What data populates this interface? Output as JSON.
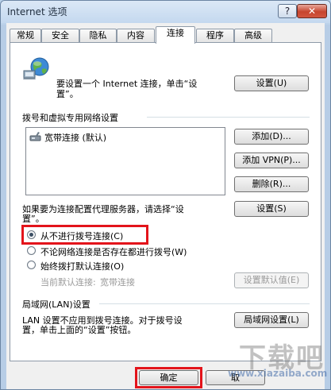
{
  "window": {
    "title": "Internet 选项",
    "help_label": "?",
    "close_label": "✕"
  },
  "tabs": [
    {
      "label": "常规",
      "active": false
    },
    {
      "label": "安全",
      "active": false
    },
    {
      "label": "隐私",
      "active": false
    },
    {
      "label": "内容",
      "active": false
    },
    {
      "label": "连接",
      "active": true
    },
    {
      "label": "程序",
      "active": false
    },
    {
      "label": "高级",
      "active": false
    }
  ],
  "connections": {
    "setup_text_line1": "要设置一个 Internet 连接，单击“设",
    "setup_text_line2": "置”。",
    "setup_button": "设置(U)",
    "dialup_section_label": "拨号和虚拟专用网络设置",
    "dialup_list": [
      {
        "label": "宽带连接 (默认)",
        "icon": "broadband-connection-icon"
      }
    ],
    "add_button": "添加(D)...",
    "add_vpn_button": "添加 VPN(P)...",
    "remove_button": "删除(R)...",
    "proxy_text_line1": "如果要为连接配置代理服务器，请选择“设",
    "proxy_text_line2": "置”。",
    "settings_button": "设置(S)",
    "radio_options": [
      {
        "label": "从不进行拨号连接(C)",
        "selected": true
      },
      {
        "label": "不论网络连接是否存在都进行拨号(W)",
        "selected": false
      },
      {
        "label": "始终拨打默认连接(O)",
        "selected": false
      }
    ],
    "current_default_label": "当前默认连接:",
    "current_default_value": "宽带连接",
    "set_default_button": "设置默认值(E)",
    "lan_section_label": "局域网(LAN)设置",
    "lan_text_line1": "LAN 设置不应用到拨号连接。对于拨号设",
    "lan_text_line2": "置，单击上面的“设置”按钮。",
    "lan_settings_button": "局域网设置(L)"
  },
  "footer": {
    "ok_button": "确定",
    "cancel_button": "取"
  },
  "watermark": {
    "line1": "下载吧",
    "line2": "www.xiazaiba.com"
  },
  "colors": {
    "highlight_box": "#e3141b",
    "accent": "#3b6ea8"
  }
}
